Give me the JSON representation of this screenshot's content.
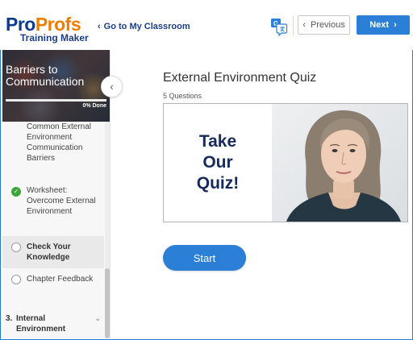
{
  "header": {
    "logo_brand_part1": "Pro",
    "logo_brand_part2": "Profs",
    "logo_subtitle": "Training Maker",
    "back_link": "Go to My Classroom",
    "translate_icon": "translate-icon",
    "translate_badge": "G",
    "prev_label": "Previous",
    "next_label": "Next"
  },
  "sidebar": {
    "course_title": "Barriers to Communication",
    "progress_label": "0% Done",
    "progress_value": 0,
    "lessons": [
      {
        "label": "Common External Environment Communication Barriers",
        "status": "none"
      },
      {
        "label": "Worksheet: Overcome External Environment",
        "status": "complete"
      },
      {
        "label": "Check Your Knowledge",
        "status": "active"
      },
      {
        "label": "Chapter Feedback",
        "status": "incomplete"
      }
    ],
    "section": {
      "number": "3.",
      "label": "Internal Environment"
    }
  },
  "main": {
    "quiz_title": "External Environment Quiz",
    "question_count": "5 Questions",
    "card_text": "Take\nOur\nQuiz!",
    "start_label": "Start"
  },
  "colors": {
    "accent": "#2b7fd6",
    "brand_blue": "#0c3b8f",
    "brand_orange": "#f07d00",
    "complete_green": "#3aa63a",
    "card_text": "#162a5c"
  }
}
